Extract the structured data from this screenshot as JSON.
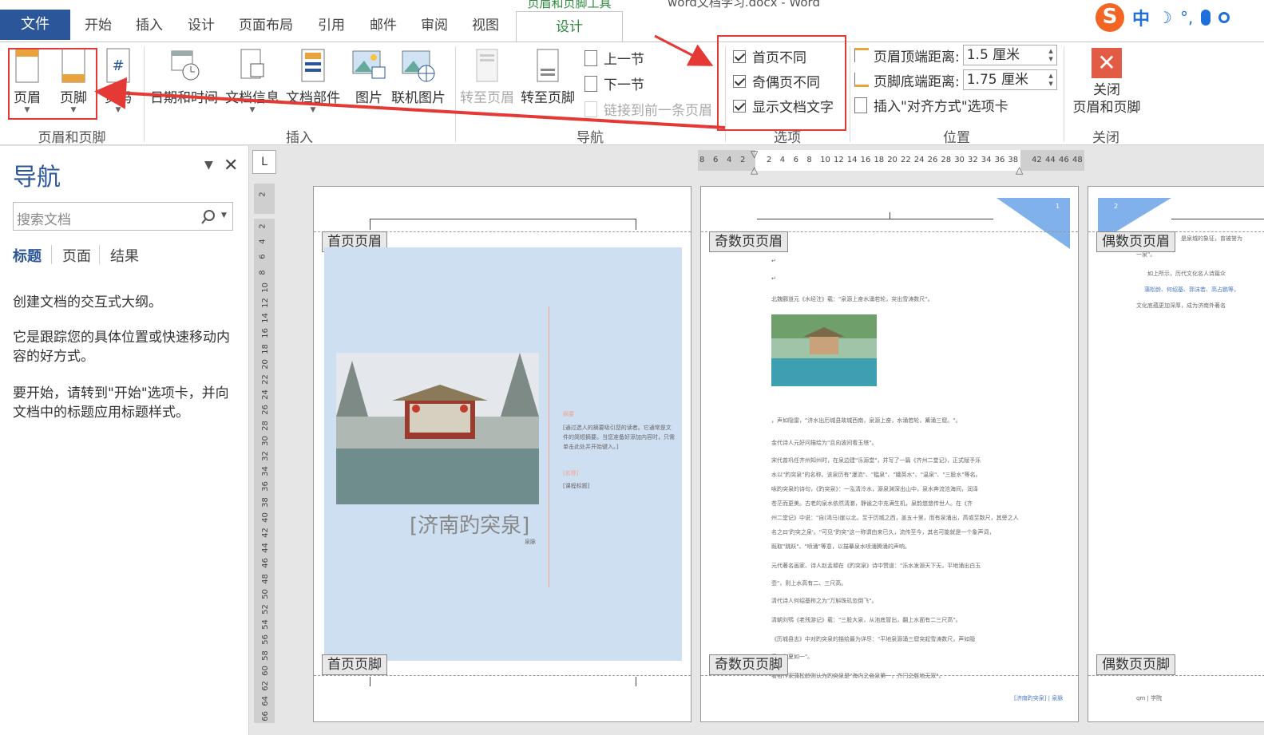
{
  "window": {
    "context_title": "页眉和页脚工具",
    "doc_title": "word文档学习.docx - Word"
  },
  "tabs": {
    "file": "文件",
    "items": [
      "开始",
      "插入",
      "设计",
      "页面布局",
      "引用",
      "邮件",
      "审阅",
      "视图"
    ],
    "active": "设计"
  },
  "ime": {
    "logo": "S",
    "lang": "中",
    "moon": "☽",
    "punct": "°,",
    "mic": "🎤",
    "tools": "🔧"
  },
  "ribbon": {
    "groups": {
      "header_footer": {
        "label": "页眉和页脚",
        "header": "页眉",
        "footer": "页脚",
        "page_number": "页码"
      },
      "insert": {
        "label": "插入",
        "datetime": "日期和时间",
        "docinfo": "文档信息",
        "docparts": "文档部件",
        "picture": "图片",
        "online_picture": "联机图片"
      },
      "navigation": {
        "label": "导航",
        "goto_header": "转至页眉",
        "goto_footer": "转至页脚",
        "prev": "上一节",
        "next": "下一节",
        "link_prev": "链接到前一条页眉"
      },
      "options": {
        "label": "选项",
        "diff_first": "首页不同",
        "diff_odd_even": "奇偶页不同",
        "show_text": "显示文档文字"
      },
      "position": {
        "label": "位置",
        "header_top_label": "页眉顶端距离:",
        "header_top_value": "1.5 厘米",
        "footer_bottom_label": "页脚底端距离:",
        "footer_bottom_value": "1.75 厘米",
        "insert_tab": "插入\"对齐方式\"选项卡"
      },
      "close": {
        "label": "关闭",
        "close_btn_line1": "关闭",
        "close_btn_line2": "页眉和页脚"
      }
    }
  },
  "nav": {
    "title": "导航",
    "search_placeholder": "搜索文档",
    "tabs": [
      "标题",
      "页面",
      "结果"
    ],
    "p1": "创建文档的交互式大纲。",
    "p2": "它是跟踪您的具体位置或快速移动内容的好方式。",
    "p3": "要开始，请转到\"开始\"选项卡，并向文档中的标题应用标题样式。"
  },
  "ruler": {
    "h_left": [
      "8",
      "6",
      "4",
      "2"
    ],
    "h_right": [
      "2",
      "4",
      "6",
      "8",
      "10",
      "12",
      "14",
      "16",
      "18",
      "20",
      "22",
      "24",
      "26",
      "28",
      "30",
      "32",
      "34",
      "36",
      "38"
    ],
    "h_far": [
      "42",
      "44",
      "46",
      "48"
    ],
    "v": [
      "2",
      "2",
      "4",
      "6",
      "8",
      "10",
      "12",
      "14",
      "16",
      "18",
      "20",
      "22",
      "24",
      "26",
      "28",
      "30",
      "32",
      "34",
      "36",
      "38",
      "40",
      "42",
      "44",
      "46",
      "48",
      "50",
      "52",
      "54",
      "56",
      "58",
      "60",
      "62",
      "64",
      "66"
    ],
    "corner": "L"
  },
  "pages": {
    "first": {
      "header_tag": "首页页眉",
      "footer_tag": "首页页脚",
      "cover_title": "[济南趵突泉]",
      "cover_sub": "泉脉",
      "abstract_label": "摘要",
      "abstract_text": "[通过选人的摘要吸引您的读者。它通常是文件的简短摘要。当您准备好添加内容时，只需单击此处并开始键入。]",
      "sidebar_a": "[名称]",
      "sidebar_b": "[课程标题]"
    },
    "odd": {
      "header_tag": "奇数页页眉",
      "footer_tag": "奇数页页脚",
      "page_num": "1",
      "lines": [
        "北魏郦道元《水经注》载：\"泉源上奋水涌若轮，突出雪涛数尺\"。",
        "，声如隐雷，\"济水出历城县故城西南，泉源上奋，水涌若轮，觱涌三窟。\"。",
        "金代诗人元好问描绘为\"且向波间看玉塔\"。",
        "宋代曾巩任齐州知州时，在泉边建\"泺源堂\"，并写了一篇《齐州二堂记》，正式赋予泺",
        "水以\"趵突泉\"的名称。该泉历有\"瀑流\"、\"槛泉\"、\"娥英水\"、\"温泉\"、\"三股水\"等名。",
        "咏趵突泉的诗句，《趵突泉》：一泓清泠水，源泉渊深出山中，泉水奔流沧海间，润泽",
        "苍茫而更美。古老的泉水依然清澈，静谧之中充满生机，泉韵悠悠传世人。在《齐",
        "州二堂记》中说：\"自(渴马)崖以北，至于历城之西，盖五十里，而有泉涌出，高或至数尺，其旁之人",
        "名之曰'趵突之泉'。\"可见\"趵突\"这一称谓由来已久，流传至今，其名可能就是一个象声词，",
        "既取\"跳跃\"、\"喷涌\"等意，以描摹泉水喷涌腾涌的声响。",
        "元代著名画家、诗人赵孟頫在《趵突泉》诗中赞道：\"泺水发源天下无，平地涌出白玉",
        "壶\"，则上水高有二、三尺高。",
        "清代诗人何绍基称之为\"万斛珠玑忽倒飞\"。",
        "清朝刘鹗《老残游记》载：\"三股大泉，从池底冒出，翻上水面有二三尺高\"。",
        "《历城县志》中对趵突泉的描绘最为详尽：\"平地泉源涌三窟突起雪涛数尺，声如隐",
        "雷，冬夏如一\"。",
        "著名作家蒲松龄则认为趵突泉是\"海内之名泉第一，齐门之胜地无双\"。"
      ],
      "footer_text": "[济南趵突泉] | 泉脉"
    },
    "even": {
      "header_tag": "偶数页页眉",
      "footer_tag": "偶数页页脚",
      "page_num": "2",
      "lines": [
        "是泉城的象征，曾被誉为",
        "一泉\"。",
        "如上所示，历代文化名人诗篇众",
        "蒲松龄、何绍基、郭沫若、高占鹏等，",
        "文化底蕴更加深厚，成为济南外著名"
      ],
      "footer_text": "qm | 学院"
    }
  },
  "colors": {
    "accent": "#2b579a",
    "design_green": "#2e8b3e",
    "annotation_red": "#e53935",
    "cover_blue": "#cfdff2",
    "triangle_blue": "#4a90e2"
  }
}
